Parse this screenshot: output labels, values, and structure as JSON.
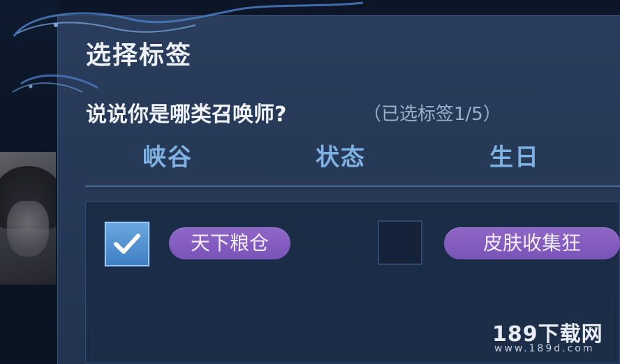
{
  "dialog": {
    "title": "选择标签",
    "question": "说说你是哪类召唤师?",
    "selected_count": "（已选标签1/5）"
  },
  "tabs": [
    {
      "label": "峡谷"
    },
    {
      "label": "状态"
    },
    {
      "label": "生日"
    }
  ],
  "tags": [
    {
      "label": "天下粮仓",
      "checked": true
    },
    {
      "label": "皮肤收集狂",
      "checked": false
    }
  ],
  "watermark": {
    "brand": "189下载网",
    "url": "www.189d.com"
  },
  "colors": {
    "panel": "#273a58",
    "tab_text": "#7fb2e3",
    "tag_purple": "#8560c0",
    "checkbox_blue": "#4f8fd0"
  },
  "icons": {
    "checkmark": "check-icon"
  }
}
